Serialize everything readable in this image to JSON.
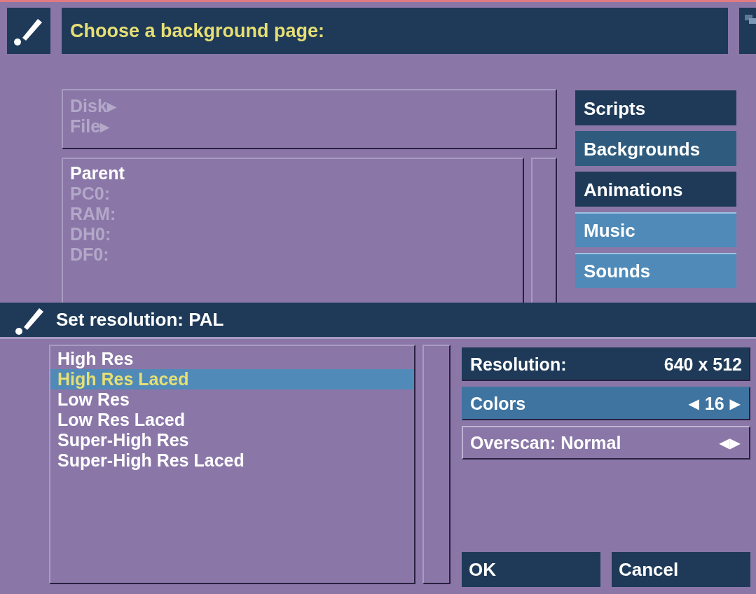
{
  "back_dialog": {
    "title": "Choose a background page:",
    "path_box": [
      {
        "label": "Disk▸",
        "disabled": true
      },
      {
        "label": "File▸",
        "disabled": true
      }
    ],
    "file_list": [
      {
        "label": "Parent",
        "disabled": false
      },
      {
        "label": "PC0:",
        "disabled": true
      },
      {
        "label": "RAM:",
        "disabled": true
      },
      {
        "label": "DH0:",
        "disabled": true
      },
      {
        "label": "DF0:",
        "disabled": true
      }
    ],
    "categories": [
      {
        "label": "Scripts",
        "kind": "dark"
      },
      {
        "label": "Backgrounds",
        "kind": "medium"
      },
      {
        "label": "Animations",
        "kind": "dark"
      },
      {
        "label": "Music",
        "kind": "light"
      },
      {
        "label": "Sounds",
        "kind": "light"
      }
    ]
  },
  "front_dialog": {
    "title": "Set resolution: PAL",
    "modes": [
      {
        "label": "High Res",
        "selected": false
      },
      {
        "label": "High Res Laced",
        "selected": true
      },
      {
        "label": "Low Res",
        "selected": false
      },
      {
        "label": "Low Res Laced",
        "selected": false
      },
      {
        "label": "Super-High Res",
        "selected": false
      },
      {
        "label": "Super-High Res Laced",
        "selected": false
      }
    ],
    "resolution": {
      "label": "Resolution:",
      "value": "640 x 512"
    },
    "colors": {
      "label": "Colors",
      "left": "◀",
      "value": "16",
      "right": "▶"
    },
    "overscan": {
      "label": "Overscan: Normal",
      "arrows": "◀▶"
    },
    "buttons": [
      "OK",
      "Cancel"
    ]
  }
}
